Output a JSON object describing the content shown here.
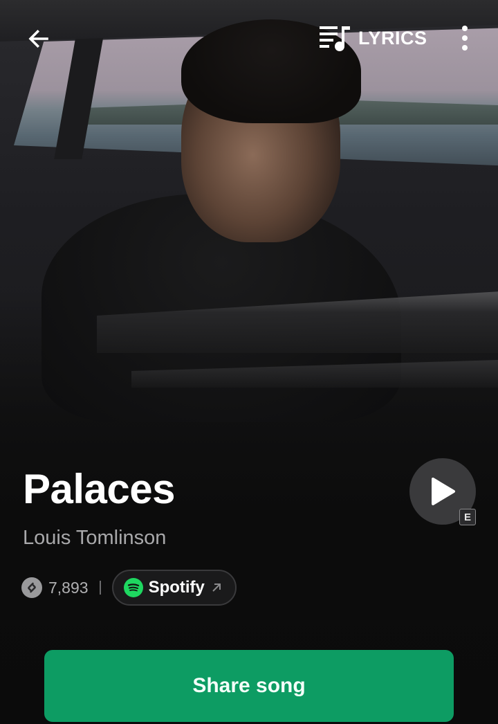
{
  "header": {
    "back_icon": "arrow-left-icon",
    "lyrics_icon": "lyrics-icon",
    "lyrics_label": "LYRICS",
    "more_icon": "more-vert-icon"
  },
  "song": {
    "title": "Palaces",
    "artist": "Louis Tomlinson",
    "explicit_badge": "E",
    "play_icon": "play-icon"
  },
  "meta": {
    "shazam_icon": "shazam-icon",
    "shazam_count": "7,893",
    "provider_icon": "spotify-icon",
    "provider_label": "Spotify",
    "external_icon": "arrow-up-right-icon"
  },
  "actions": {
    "share_label": "Share song"
  },
  "colors": {
    "accent_green": "#0d9c63",
    "spotify_green": "#1ed760",
    "background": "#0b0b0b"
  }
}
